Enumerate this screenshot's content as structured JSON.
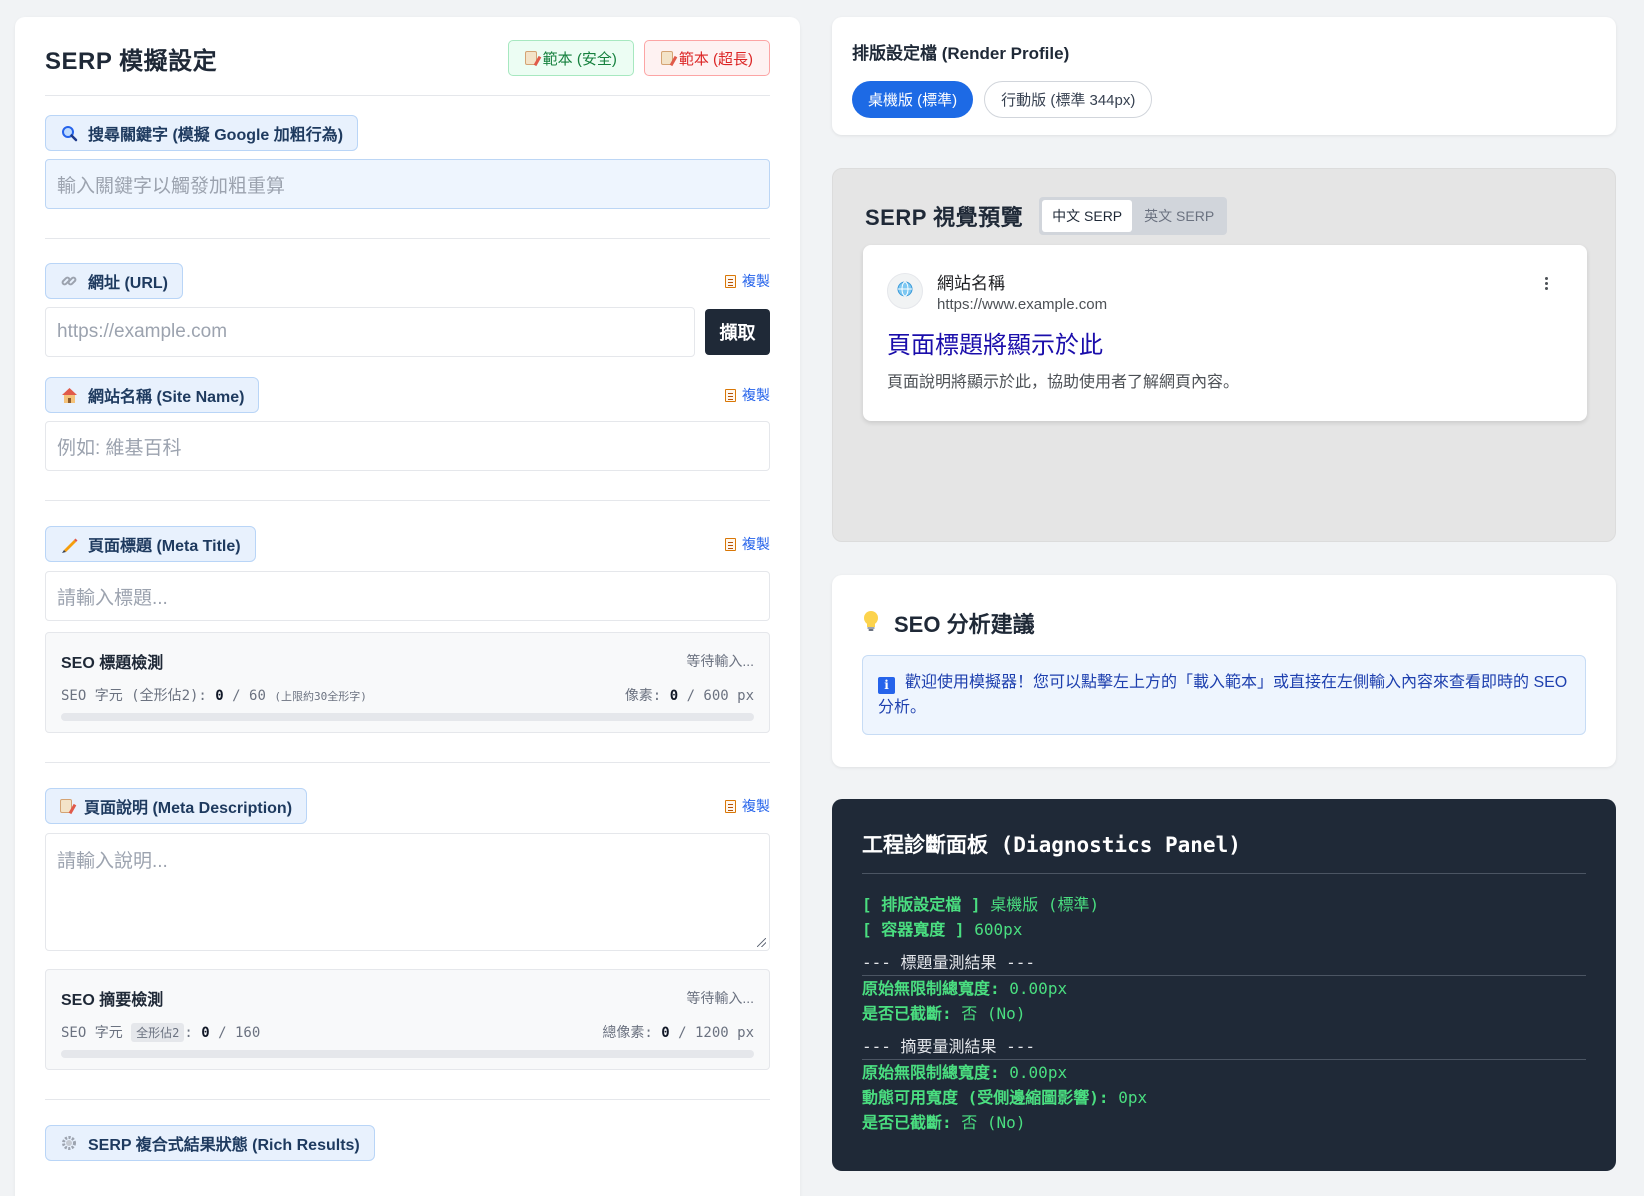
{
  "left": {
    "title": "SERP 模擬設定",
    "btn_safe": "範本 (安全)",
    "btn_long": "範本 (超長)",
    "keyword_label": "搜尋關鍵字 (模擬 Google 加粗行為)",
    "keyword_placeholder": "輸入關鍵字以觸發加粗重算",
    "url_label": "網址 (URL)",
    "url_placeholder": "https://example.com",
    "fetch_label": "擷取",
    "copy_label": "複製",
    "site_label": "網站名稱 (Site Name)",
    "site_placeholder": "例如: 維基百科",
    "title_label": "頁面標題 (Meta Title)",
    "title_placeholder": "請輸入標題...",
    "title_check": {
      "heading": "SEO 標題檢測",
      "status": "等待輸入...",
      "chars_prefix": "SEO 字元 (全形佔2):",
      "chars_value": "0",
      "chars_max": "/ 60",
      "chars_note": "(上限約30全形字)",
      "px_prefix": "像素:",
      "px_value": "0",
      "px_max": "/ 600 px",
      "progress": 0
    },
    "desc_label": "頁面說明 (Meta Description)",
    "desc_placeholder": "請輸入說明...",
    "desc_check": {
      "heading": "SEO 摘要檢測",
      "status": "等待輸入...",
      "chars_prefix": "SEO 字元",
      "chars_tag": "全形佔2",
      "chars_value": "0",
      "chars_max": "/ 160",
      "px_prefix": "總像素:",
      "px_value": "0",
      "px_max": "/ 1200 px",
      "progress": 0
    },
    "rich_label": "SERP 複合式結果狀態 (Rich Results)"
  },
  "profile": {
    "title": "排版設定檔 (Render Profile)",
    "desktop": "桌機版 (標準)",
    "mobile": "行動版 (標準 344px)"
  },
  "preview": {
    "title": "SERP 視覺預覽",
    "lang_zh": "中文 SERP",
    "lang_en": "英文 SERP",
    "site_name": "網站名稱",
    "url": "https://www.example.com",
    "page_title": "頁面標題將顯示於此",
    "page_desc": "頁面說明將顯示於此，協助使用者了解網頁內容。"
  },
  "seo": {
    "title": "SEO 分析建議",
    "info": "歡迎使用模擬器！您可以點擊左上方的「載入範本」或直接在左側輸入內容來查看即時的 SEO 分析。"
  },
  "diag": {
    "title": "工程診斷面板 (Diagnostics Panel)",
    "profile_key": "[ 排版設定檔 ]",
    "profile_val": "桌機版 (標準)",
    "width_key": "[ 容器寬度 ]",
    "width_val": "600px",
    "title_sep": "--- 標題量測結果 ---",
    "t_raw_key": "原始無限制總寬度:",
    "t_raw_val": "0.00px",
    "t_trunc_key": "是否已截斷:",
    "t_trunc_val": "否 (No)",
    "desc_sep": "--- 摘要量測結果 ---",
    "d_raw_key": "原始無限制總寬度:",
    "d_raw_val": "0.00px",
    "d_dyn_key": "動態可用寬度 (受側邊縮圖影響):",
    "d_dyn_val": "0px",
    "d_trunc_key": "是否已截斷:",
    "d_trunc_val": "否 (No)"
  },
  "colors": {
    "accent": "#1d6ae5",
    "serp_title": "#1a0dab",
    "diag_green": "#4ade80",
    "diag_bg": "#1f2937"
  }
}
